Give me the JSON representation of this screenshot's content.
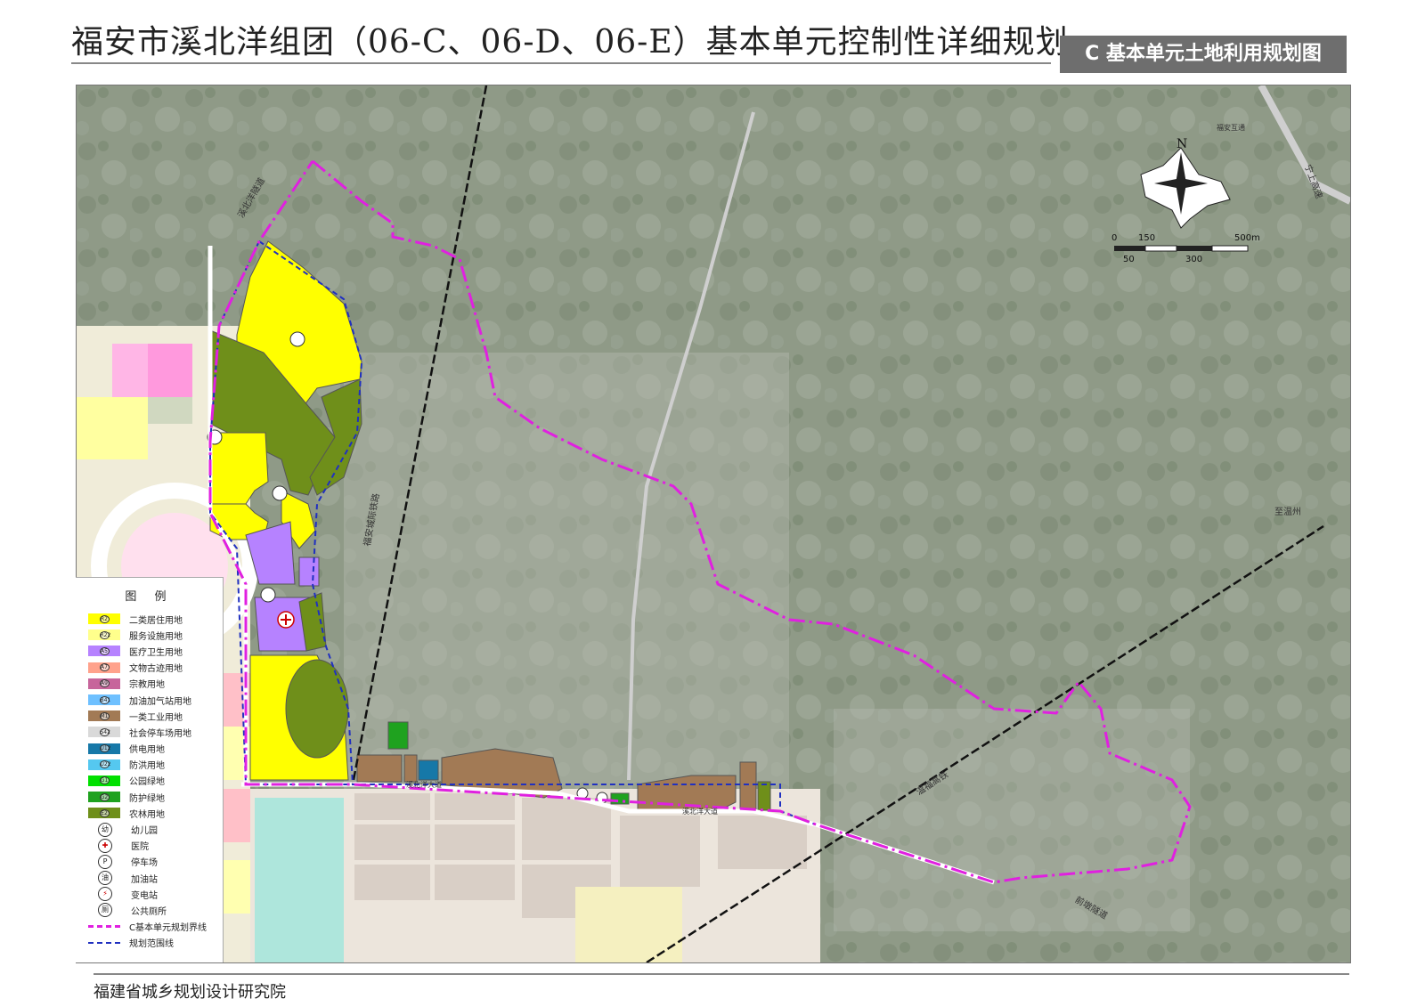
{
  "title": "福安市溪北洋组团（06-C、06-D、06-E）基本单元控制性详细规划",
  "subtitle": "C 基本单元土地利用规划图",
  "footer": "福建省城乡规划设计研究院",
  "north_label": "N",
  "scale": {
    "labels_top": [
      "0",
      "150",
      "500m"
    ],
    "labels_bottom": [
      "50",
      "300"
    ]
  },
  "map_labels": {
    "road_xibeiyang": "溪北洋隧道",
    "railway_label": "福安城际铁路",
    "highspeed_label": "温福高铁",
    "tunnel_label": "前墩隧道",
    "to_wenzhou": "至温州",
    "fuan_interchange": "福安互通",
    "highway_label": "宁上高速",
    "road_avenue1": "溪北洋大道",
    "road_avenue2": "溪北洋大道"
  },
  "legend": {
    "title": "图 例",
    "items": [
      {
        "code": "R2",
        "label": "二类居住用地",
        "color": "#ffff00"
      },
      {
        "code": "R22",
        "label": "服务设施用地",
        "color": "#ffff8c"
      },
      {
        "code": "A5",
        "label": "医疗卫生用地",
        "color": "#b682ff"
      },
      {
        "code": "A7",
        "label": "文物古迹用地",
        "color": "#ffa28c"
      },
      {
        "code": "A9",
        "label": "宗教用地",
        "color": "#c7659b"
      },
      {
        "code": "B41",
        "label": "加油加气站用地",
        "color": "#6ec0ff"
      },
      {
        "code": "M1",
        "label": "一类工业用地",
        "color": "#a27a55"
      },
      {
        "code": "S42",
        "label": "社会停车场用地",
        "color": "#d9d9d9"
      },
      {
        "code": "U12",
        "label": "供电用地",
        "color": "#1678a8"
      },
      {
        "code": "U22",
        "label": "防洪用地",
        "color": "#55c8f0"
      },
      {
        "code": "G1",
        "label": "公园绿地",
        "color": "#00e000"
      },
      {
        "code": "G2",
        "label": "防护绿地",
        "color": "#1fa21f"
      },
      {
        "code": "E2",
        "label": "农林用地",
        "color": "#6f8f1a"
      }
    ],
    "symbols": [
      {
        "glyph": "幼",
        "label": "幼儿园"
      },
      {
        "glyph": "✚",
        "label": "医院"
      },
      {
        "glyph": "P",
        "label": "停车场"
      },
      {
        "glyph": "油",
        "label": "加油站"
      },
      {
        "glyph": "⚡",
        "label": "变电站"
      },
      {
        "glyph": "厕",
        "label": "公共厕所"
      }
    ],
    "lines": [
      {
        "label": "C基本单元规划界线",
        "style": "magenta-dashdot"
      },
      {
        "label": "规划范围线",
        "style": "blue-dashed"
      }
    ]
  }
}
